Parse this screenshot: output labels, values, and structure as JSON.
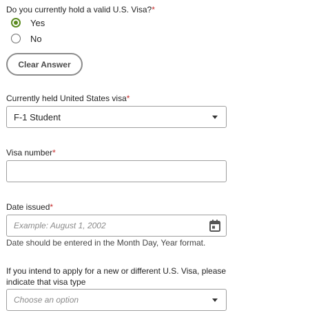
{
  "visa_question": {
    "label": "Do you currently hold a valid U.S. Visa?",
    "required_marker": "*",
    "options": [
      {
        "label": "Yes",
        "selected": true
      },
      {
        "label": "No",
        "selected": false
      }
    ],
    "clear_label": "Clear Answer"
  },
  "current_visa": {
    "label": "Currently held United States visa",
    "required_marker": "*",
    "value": "F-1  Student"
  },
  "visa_number": {
    "label": "Visa number",
    "required_marker": "*",
    "value": ""
  },
  "date_issued": {
    "label": "Date issued",
    "required_marker": "*",
    "placeholder": "Example: August 1, 2002",
    "helper": "Date should be entered in the Month Day, Year format."
  },
  "intended_visa": {
    "label_line1": "If you intend to apply for a new or different U.S. Visa, please",
    "label_line2": "indicate that visa type",
    "placeholder": "Choose an option"
  },
  "colors": {
    "accent_green": "#5a8a1e",
    "required_red": "#c62828",
    "border_gray": "#9e9e9e"
  },
  "icons": [
    "calendar-icon",
    "chevron-down-icon"
  ]
}
